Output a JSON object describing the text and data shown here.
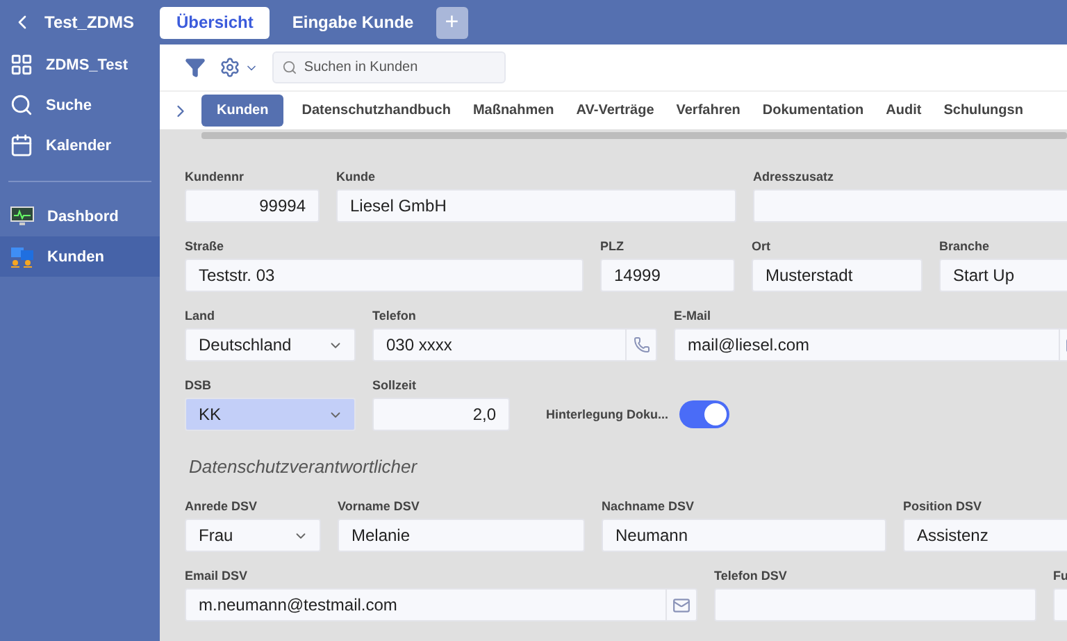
{
  "app": {
    "title": "Test_ZDMS"
  },
  "top_tabs": [
    {
      "label": "Übersicht",
      "selected": true
    },
    {
      "label": "Eingabe Kunde",
      "selected": false
    }
  ],
  "add_tab": {
    "label": "+"
  },
  "sidebar": {
    "items": [
      {
        "label": "ZDMS_Test",
        "selected": false
      },
      {
        "label": "Suche",
        "selected": false
      },
      {
        "label": "Kalender",
        "selected": false
      },
      {
        "label": "Dashbord",
        "selected": false
      },
      {
        "label": "Kunden",
        "selected": true
      }
    ]
  },
  "toolbar": {
    "search": {
      "placeholder": "Suchen in Kunden"
    }
  },
  "tabs": [
    {
      "label": "Kunden",
      "selected": true
    },
    {
      "label": "Datenschutzhandbuch",
      "selected": false
    },
    {
      "label": "Maßnahmen",
      "selected": false
    },
    {
      "label": "AV-Verträge",
      "selected": false
    },
    {
      "label": "Verfahren",
      "selected": false
    },
    {
      "label": "Dokumentation",
      "selected": false
    },
    {
      "label": "Audit",
      "selected": false
    },
    {
      "label": "Schulungsn",
      "selected": false
    }
  ],
  "form": {
    "rows": [
      [
        {
          "kind": "number",
          "label": "Kundennr",
          "value": "99994"
        },
        {
          "kind": "text",
          "label": "Kunde",
          "value": "Liesel GmbH"
        },
        {
          "kind": "text",
          "label": "Adresszusatz"
        }
      ],
      [
        {
          "kind": "text",
          "label": "Straße",
          "value": "Teststr. 03"
        },
        {
          "kind": "text",
          "label": "PLZ",
          "value": "14999"
        },
        {
          "kind": "text",
          "label": "Ort",
          "value": "Musterstadt"
        },
        {
          "kind": "text",
          "label": "Branche",
          "value": "Start Up"
        }
      ],
      [
        {
          "kind": "select",
          "label": "Land",
          "value": "Deutschland"
        },
        {
          "kind": "phone",
          "label": "Telefon",
          "value": "030 xxxx"
        },
        {
          "kind": "email",
          "label": "E-Mail",
          "value": "mail@liesel.com"
        }
      ],
      [
        {
          "kind": "select",
          "label": "DSB",
          "value": "KK",
          "highlighted": true
        },
        {
          "kind": "number",
          "label": "Sollzeit",
          "value": "2,0"
        },
        {
          "kind": "toggle",
          "label": "Hinterlegung Doku...",
          "on": true
        }
      ]
    ],
    "section_title": "Datenschutzverantwortlicher",
    "section_rows": [
      [
        {
          "kind": "select",
          "label": "Anrede DSV",
          "value": "Frau"
        },
        {
          "kind": "text",
          "label": "Vorname DSV",
          "value": "Melanie"
        },
        {
          "kind": "text",
          "label": "Nachname DSV",
          "value": "Neumann"
        },
        {
          "kind": "text",
          "label": "Position DSV",
          "value": "Assistenz"
        }
      ],
      [
        {
          "kind": "email",
          "label": "Email DSV",
          "value": "m.neumann@testmail.com"
        },
        {
          "kind": "text",
          "label": "Telefon DSV"
        },
        {
          "kind": "text",
          "label": "Fu"
        }
      ]
    ]
  }
}
